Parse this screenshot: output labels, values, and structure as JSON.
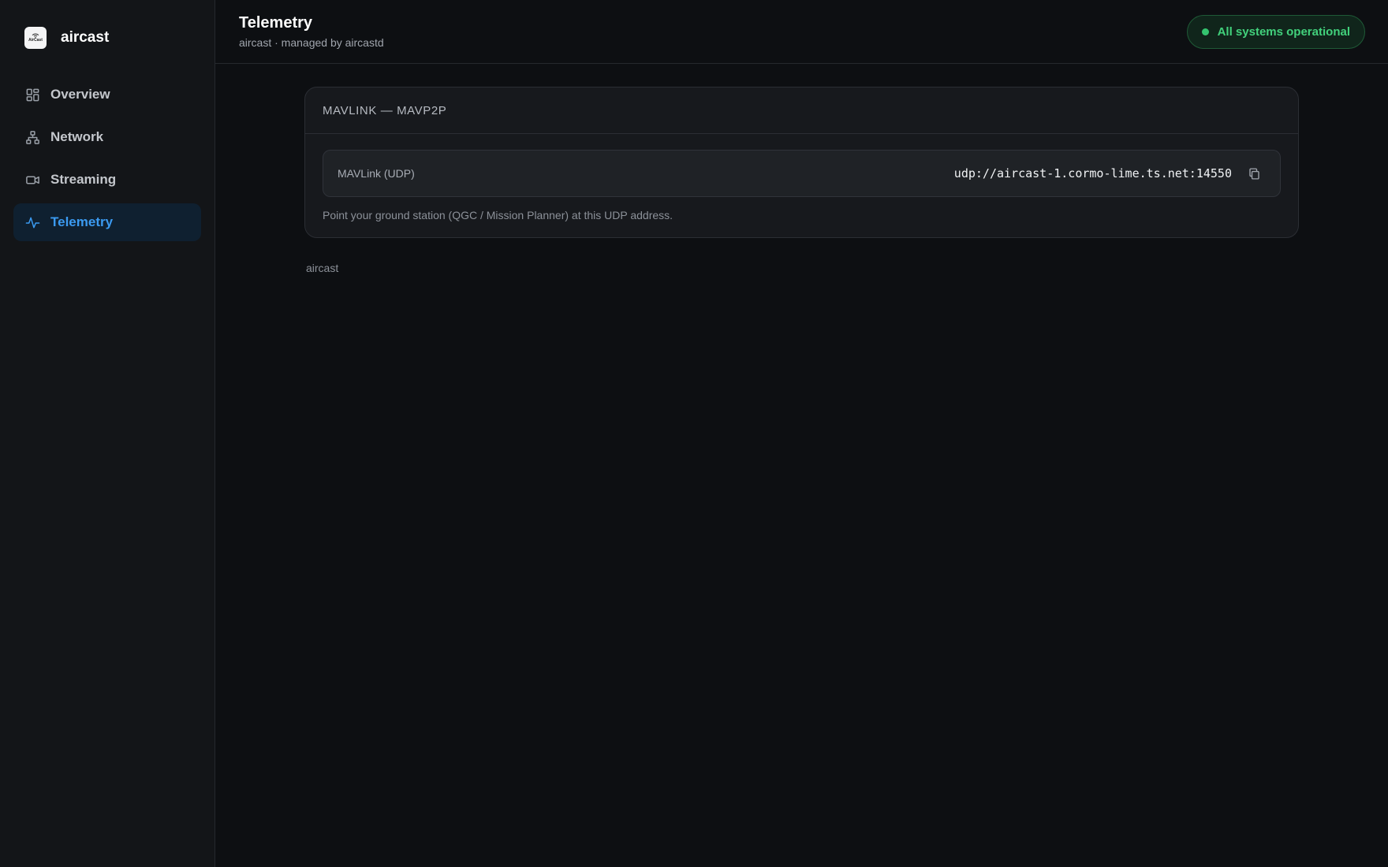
{
  "brand": {
    "name": "aircast",
    "logo_text": "AirCast"
  },
  "sidebar": {
    "items": [
      {
        "label": "Overview",
        "icon": "grid-icon"
      },
      {
        "label": "Network",
        "icon": "network-icon"
      },
      {
        "label": "Streaming",
        "icon": "video-camera-icon"
      },
      {
        "label": "Telemetry",
        "icon": "activity-icon",
        "active": true
      }
    ]
  },
  "header": {
    "title": "Telemetry",
    "subtitle": "aircast · managed by aircastd",
    "status": "All systems operational"
  },
  "card": {
    "title": "MAVLINK — MAVP2P",
    "field_label": "MAVLink (UDP)",
    "field_value": "udp://aircast-1.cormo-lime.ts.net:14550",
    "hint": "Point your ground station (QGC / Mission Planner) at this UDP address."
  },
  "footer": {
    "text": "aircast"
  },
  "colors": {
    "accent": "#3b9af0",
    "status_green": "#42d17c",
    "background": "#0d0f12",
    "sidebar_bg": "#131518"
  }
}
